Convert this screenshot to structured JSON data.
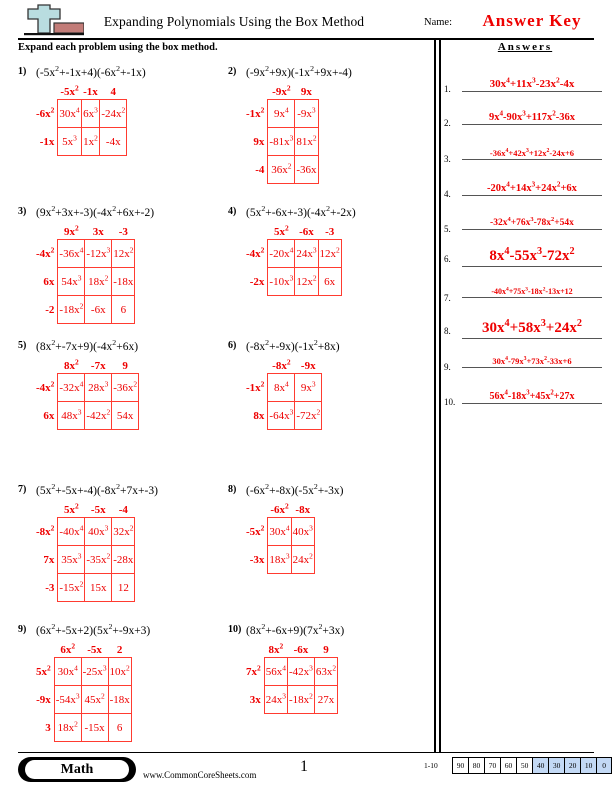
{
  "header": {
    "title": "Expanding Polynomials Using the Box Method",
    "name_label": "Name:",
    "answer_key": "Answer Key",
    "instructions": "Expand each problem using the box method.",
    "answers_heading": "Answers",
    "logo_icon": "plus-block-logo"
  },
  "colors": {
    "accent_red": "#ee0000",
    "box_border": "#ff3b30",
    "scale_highlight": "#c3d9f5"
  },
  "problems": [
    {
      "num": "1)",
      "expression": "(-5x<sup>2</sup>+-1x+4)(-6x<sup>2</sup>+-1x)",
      "cols": [
        "-5x<sup>2</sup>",
        "-1x",
        "4"
      ],
      "rows": [
        "-6x<sup>2</sup>",
        "-1x"
      ],
      "cells": [
        [
          "30x<sup>4</sup>",
          "6x<sup>3</sup>",
          "-24x<sup>2</sup>"
        ],
        [
          "5x<sup>3</sup>",
          "1x<sup>2</sup>",
          "-4x"
        ]
      ]
    },
    {
      "num": "2)",
      "expression": "(-9x<sup>2</sup>+9x)(-1x<sup>2</sup>+9x+-4)",
      "cols": [
        "-9x<sup>2</sup>",
        "9x"
      ],
      "rows": [
        "-1x<sup>2</sup>",
        "9x",
        "-4"
      ],
      "cells": [
        [
          "9x<sup>4</sup>",
          "-9x<sup>3</sup>"
        ],
        [
          "-81x<sup>3</sup>",
          "81x<sup>2</sup>"
        ],
        [
          "36x<sup>2</sup>",
          "-36x"
        ]
      ]
    },
    {
      "num": "3)",
      "expression": "(9x<sup>2</sup>+3x+-3)(-4x<sup>2</sup>+6x+-2)",
      "cols": [
        "9x<sup>2</sup>",
        "3x",
        "-3"
      ],
      "rows": [
        "-4x<sup>2</sup>",
        "6x",
        "-2"
      ],
      "cells": [
        [
          "-36x<sup>4</sup>",
          "-12x<sup>3</sup>",
          "12x<sup>2</sup>"
        ],
        [
          "54x<sup>3</sup>",
          "18x<sup>2</sup>",
          "-18x"
        ],
        [
          "-18x<sup>2</sup>",
          "-6x",
          "6"
        ]
      ]
    },
    {
      "num": "4)",
      "expression": "(5x<sup>2</sup>+-6x+-3)(-4x<sup>2</sup>+-2x)",
      "cols": [
        "5x<sup>2</sup>",
        "-6x",
        "-3"
      ],
      "rows": [
        "-4x<sup>2</sup>",
        "-2x"
      ],
      "cells": [
        [
          "-20x<sup>4</sup>",
          "24x<sup>3</sup>",
          "12x<sup>2</sup>"
        ],
        [
          "-10x<sup>3</sup>",
          "12x<sup>2</sup>",
          "6x"
        ]
      ]
    },
    {
      "num": "5)",
      "expression": "(8x<sup>2</sup>+-7x+9)(-4x<sup>2</sup>+6x)",
      "cols": [
        "8x<sup>2</sup>",
        "-7x",
        "9"
      ],
      "rows": [
        "-4x<sup>2</sup>",
        "6x"
      ],
      "cells": [
        [
          "-32x<sup>4</sup>",
          "28x<sup>3</sup>",
          "-36x<sup>2</sup>"
        ],
        [
          "48x<sup>3</sup>",
          "-42x<sup>2</sup>",
          "54x"
        ]
      ]
    },
    {
      "num": "6)",
      "expression": "(-8x<sup>2</sup>+-9x)(-1x<sup>2</sup>+8x)",
      "cols": [
        "-8x<sup>2</sup>",
        "-9x"
      ],
      "rows": [
        "-1x<sup>2</sup>",
        "8x"
      ],
      "cells": [
        [
          "8x<sup>4</sup>",
          "9x<sup>3</sup>"
        ],
        [
          "-64x<sup>3</sup>",
          "-72x<sup>2</sup>"
        ]
      ]
    },
    {
      "num": "7)",
      "expression": "(5x<sup>2</sup>+-5x+-4)(-8x<sup>2</sup>+7x+-3)",
      "cols": [
        "5x<sup>2</sup>",
        "-5x",
        "-4"
      ],
      "rows": [
        "-8x<sup>2</sup>",
        "7x",
        "-3"
      ],
      "cells": [
        [
          "-40x<sup>4</sup>",
          "40x<sup>3</sup>",
          "32x<sup>2</sup>"
        ],
        [
          "35x<sup>3</sup>",
          "-35x<sup>2</sup>",
          "-28x"
        ],
        [
          "-15x<sup>2</sup>",
          "15x",
          "12"
        ]
      ]
    },
    {
      "num": "8)",
      "expression": "(-6x<sup>2</sup>+-8x)(-5x<sup>2</sup>+-3x)",
      "cols": [
        "-6x<sup>2</sup>",
        "-8x"
      ],
      "rows": [
        "-5x<sup>2</sup>",
        "-3x"
      ],
      "cells": [
        [
          "30x<sup>4</sup>",
          "40x<sup>3</sup>"
        ],
        [
          "18x<sup>3</sup>",
          "24x<sup>2</sup>"
        ]
      ]
    },
    {
      "num": "9)",
      "expression": "(6x<sup>2</sup>+-5x+2)(5x<sup>2</sup>+-9x+3)",
      "cols": [
        "6x<sup>2</sup>",
        "-5x",
        "2"
      ],
      "rows": [
        "5x<sup>2</sup>",
        "-9x",
        "3"
      ],
      "cells": [
        [
          "30x<sup>4</sup>",
          "-25x<sup>3</sup>",
          "10x<sup>2</sup>"
        ],
        [
          "-54x<sup>3</sup>",
          "45x<sup>2</sup>",
          "-18x"
        ],
        [
          "18x<sup>2</sup>",
          "-15x",
          "6"
        ]
      ]
    },
    {
      "num": "10)",
      "expression": "(8x<sup>2</sup>+-6x+9)(7x<sup>2</sup>+3x)",
      "cols": [
        "8x<sup>2</sup>",
        "-6x",
        "9"
      ],
      "rows": [
        "7x<sup>2</sup>",
        "3x"
      ],
      "cells": [
        [
          "56x<sup>4</sup>",
          "-42x<sup>3</sup>",
          "63x<sup>2</sup>"
        ],
        [
          "24x<sup>3</sup>",
          "-18x<sup>2</sup>",
          "27x"
        ]
      ]
    }
  ],
  "answers": [
    {
      "num": "1.",
      "text": "30x<sup>4</sup>+11x<sup>3</sup>-23x<sup>2</sup>-4x",
      "size": 11
    },
    {
      "num": "2.",
      "text": "9x<sup>4</sup>-90x<sup>3</sup>+117x<sup>2</sup>-36x",
      "size": 10.5
    },
    {
      "num": "3.",
      "text": "-36x<sup>4</sup>+42x<sup>3</sup>+12x<sup>2</sup>-24x+6",
      "size": 8.5
    },
    {
      "num": "4.",
      "text": "-20x<sup>4</sup>+14x<sup>3</sup>+24x<sup>2</sup>+6x",
      "size": 10.5
    },
    {
      "num": "5.",
      "text": "-32x<sup>4</sup>+76x<sup>3</sup>-78x<sup>2</sup>+54x",
      "size": 9.5
    },
    {
      "num": "6.",
      "text": "8x<sup>4</sup>-55x<sup>3</sup>-72x<sup>2</sup>",
      "size": 15
    },
    {
      "num": "7.",
      "text": "-40x<sup>4</sup>+75x<sup>3</sup>-18x<sup>2</sup>-13x+12",
      "size": 8
    },
    {
      "num": "8.",
      "text": "30x<sup>4</sup>+58x<sup>3</sup>+24x<sup>2</sup>",
      "size": 15
    },
    {
      "num": "9.",
      "text": "30x<sup>4</sup>-79x<sup>3</sup>+73x<sup>2</sup>-33x+6",
      "size": 8.5
    },
    {
      "num": "10.",
      "text": "56x<sup>4</sup>-18x<sup>3</sup>+45x<sup>2</sup>+27x",
      "size": 10
    }
  ],
  "footer": {
    "subject_badge": "Math",
    "website": "www.CommonCoreSheets.com",
    "page_number": "1",
    "scale_label": "1-10",
    "scale_values": [
      "90",
      "80",
      "70",
      "60",
      "50",
      "40",
      "30",
      "20",
      "10",
      "0"
    ],
    "scale_highlight_from_index": 5
  }
}
